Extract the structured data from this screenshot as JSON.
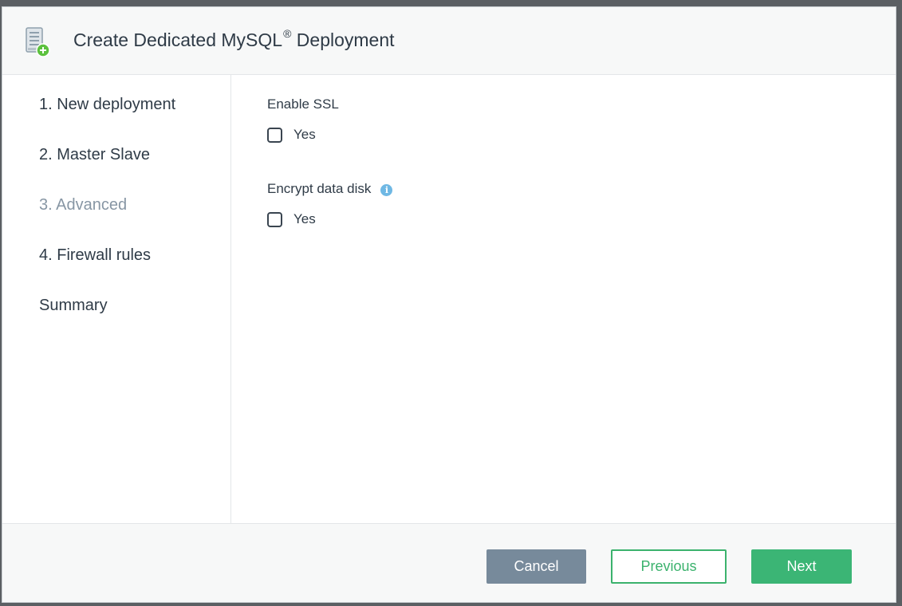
{
  "dialog": {
    "title": "Create Dedicated MySQL",
    "title_sup": "®",
    "title_suffix": " Deployment",
    "icon": "server-add-icon"
  },
  "sidebar": {
    "steps": [
      {
        "label": "1. New deployment",
        "active": false
      },
      {
        "label": "2. Master Slave",
        "active": false
      },
      {
        "label": "3. Advanced",
        "active": true
      },
      {
        "label": "4. Firewall rules",
        "active": false
      },
      {
        "label": "Summary",
        "active": false
      }
    ]
  },
  "form": {
    "ssl": {
      "label": "Enable SSL",
      "checkbox_label": "Yes",
      "checked": false
    },
    "encrypt": {
      "label": "Encrypt data disk",
      "info_icon": "info-icon",
      "info_glyph": "i",
      "checkbox_label": "Yes",
      "checked": false
    }
  },
  "footer": {
    "cancel_label": "Cancel",
    "previous_label": "Previous",
    "next_label": "Next"
  },
  "colors": {
    "accent_green": "#3bb575",
    "cancel_gray": "#778a9b",
    "text_dark": "#2f3b47",
    "active_step": "#8796a4",
    "info_blue": "#6fb8e4"
  }
}
